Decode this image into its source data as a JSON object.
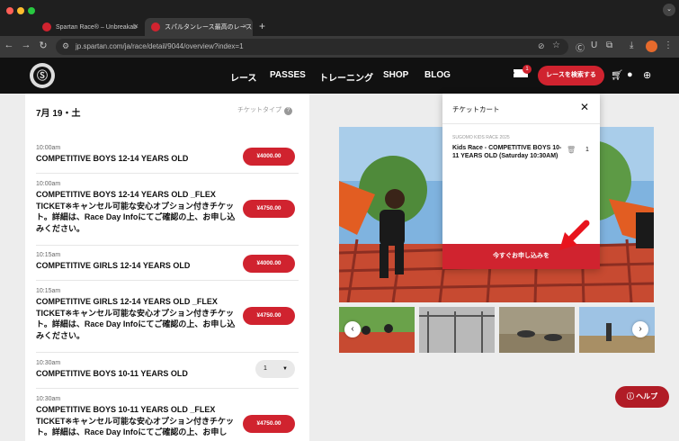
{
  "browser": {
    "tabs": [
      {
        "title": "Spartan Race® – Unbreakab"
      },
      {
        "title": "スパルタンレース最高のレース"
      }
    ],
    "new_tab": "+",
    "url": "jp.spartan.com/ja/race/detail/9044/overview?index=1"
  },
  "header": {
    "nav": [
      "レース",
      "PASSES",
      "トレーニング",
      "SHOP",
      "BLOG"
    ],
    "cart_count": "1",
    "search_label": "レースを検索する"
  },
  "schedule": {
    "date": "7月 19・土",
    "ticket_type_label": "チケットタイプ",
    "events": [
      {
        "time": "10:00am",
        "name": "COMPETITIVE BOYS 12-14 YEARS OLD",
        "price": "¥4000.00"
      },
      {
        "time": "10:00am",
        "name": "COMPETITIVE BOYS 12-14 YEARS OLD _FLEX TICKET※キャンセル可能な安心オプション付きチケット。詳細は、Race Day Infoにてご確認の上、お申し込みください。",
        "price": "¥4750.00"
      },
      {
        "time": "10:15am",
        "name": "COMPETITIVE GIRLS 12-14 YEARS OLD",
        "price": "¥4000.00"
      },
      {
        "time": "10:15am",
        "name": "COMPETITIVE GIRLS 12-14 YEARS OLD _FLEX TICKET※キャンセル可能な安心オプション付きチケット。詳細は、Race Day Infoにてご確認の上、お申し込みください。",
        "price": "¥4750.00"
      },
      {
        "time": "10:30am",
        "name": "COMPETITIVE BOYS 10-11 YEARS OLD",
        "quantity": "1"
      },
      {
        "time": "10:30am",
        "name": "COMPETITIVE BOYS 10-11 YEARS OLD _FLEX TICKET※キャンセル可能な安心オプション付きチケット。詳細は、Race Day Infoにてご確認の上、お申し",
        "price": "¥4750.00"
      }
    ]
  },
  "cart": {
    "title": "チケットカート",
    "race": "SUGOMO KIDS RACE 2025",
    "item": "Kids Race - COMPETITIVE BOYS 10-11 YEARS OLD (Saturday 10:30AM)",
    "quantity": "1",
    "apply_label": "今すぐお申し込みを"
  },
  "gallery": {
    "prev": "‹",
    "next": "›"
  },
  "help_label": "ヘルプ",
  "colors": {
    "brand_red": "#d0232f",
    "header_bg": "#111111"
  }
}
